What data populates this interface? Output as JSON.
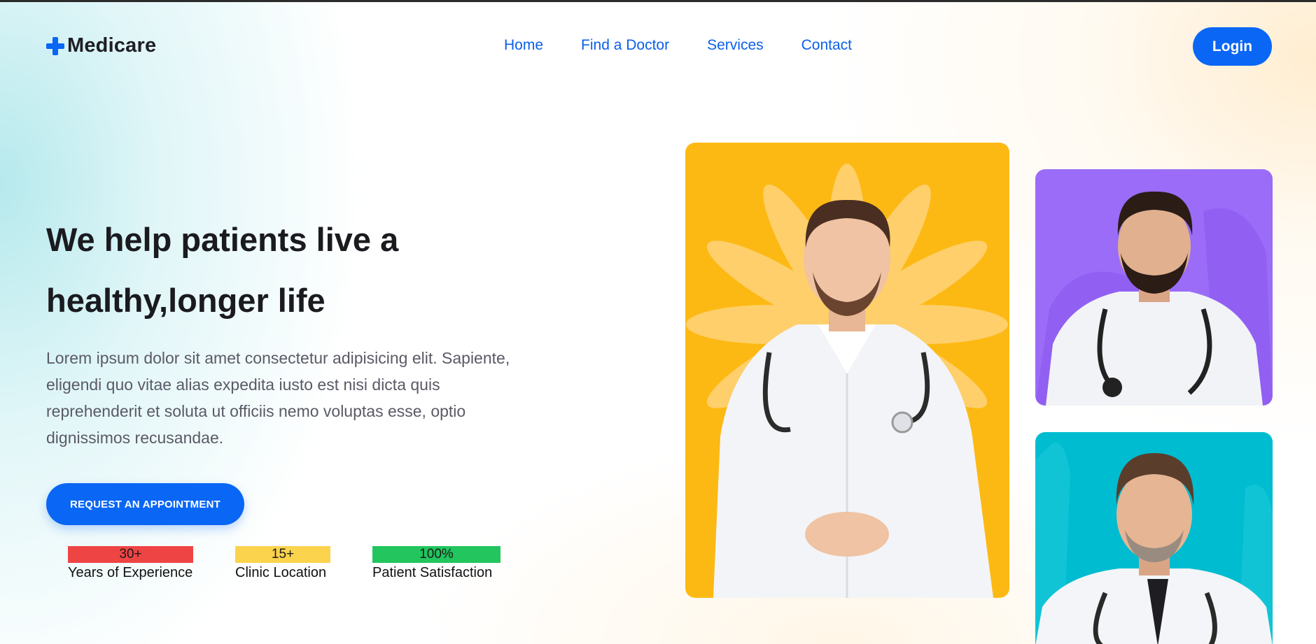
{
  "brand": {
    "name": "Medicare",
    "icon": "plus-cross-icon",
    "accent": "#0a66f5"
  },
  "nav": {
    "items": [
      {
        "label": "Home"
      },
      {
        "label": "Find a Doctor"
      },
      {
        "label": "Services"
      },
      {
        "label": "Contact"
      }
    ],
    "login_label": "Login"
  },
  "hero": {
    "title_line1": "We help patients live a",
    "title_line2": "healthy,longer life",
    "description": "Lorem ipsum dolor sit amet consectetur adipisicing elit. Sapiente, eligendi quo vitae alias expedita iusto est nisi dicta quis reprehenderit et soluta ut officiis nemo voluptas esse, optio dignissimos recusandae.",
    "cta_label": "REQUEST AN APPOINTMENT"
  },
  "stats": [
    {
      "value": "30+",
      "label": "Years of Experience",
      "color": "#ef4444"
    },
    {
      "value": "15+",
      "label": "Clinic Location",
      "color": "#fcd34d"
    },
    {
      "value": "100%",
      "label": "Patient Satisfaction",
      "color": "#22c55e"
    }
  ],
  "doctor_cards": [
    {
      "background": "#fdb913"
    },
    {
      "background": "#9b6cf7"
    },
    {
      "background": "#00bcd0"
    }
  ]
}
